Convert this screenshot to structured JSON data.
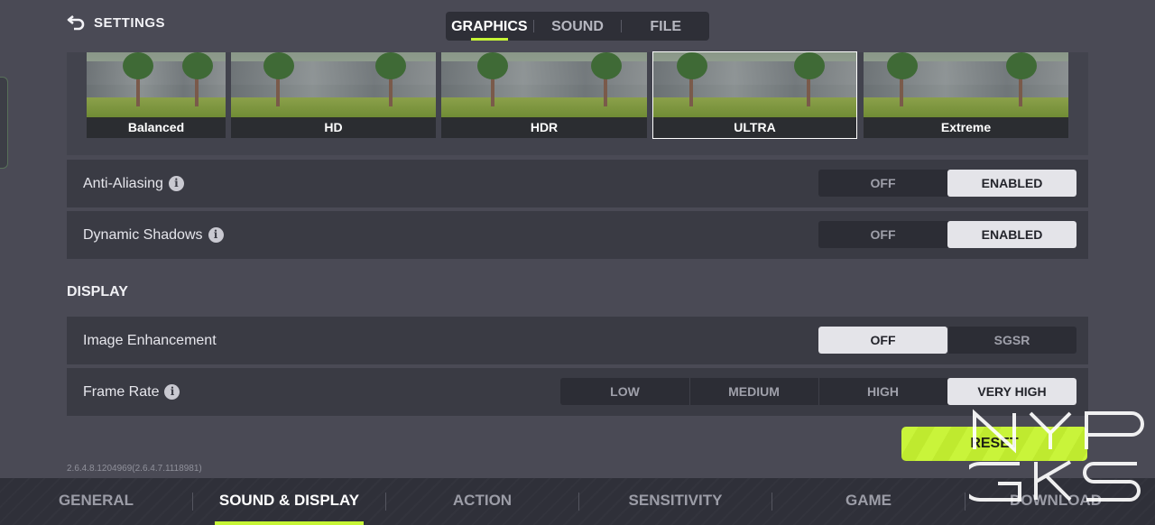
{
  "header": {
    "back_label": "SETTINGS",
    "tabs": [
      {
        "label": "GRAPHICS",
        "active": true
      },
      {
        "label": "SOUND",
        "active": false
      },
      {
        "label": "FILE",
        "active": false
      }
    ]
  },
  "presets": [
    {
      "label": "Balanced",
      "selected": false
    },
    {
      "label": "HD",
      "selected": false
    },
    {
      "label": "HDR",
      "selected": false
    },
    {
      "label": "ULTRA",
      "selected": true
    },
    {
      "label": "Extreme",
      "selected": false
    }
  ],
  "graphics_rows": {
    "anti_aliasing": {
      "label": "Anti-Aliasing",
      "options": [
        "OFF",
        "ENABLED"
      ],
      "selected": "ENABLED"
    },
    "dynamic_shadows": {
      "label": "Dynamic Shadows",
      "options": [
        "OFF",
        "ENABLED"
      ],
      "selected": "ENABLED"
    }
  },
  "display": {
    "title": "DISPLAY",
    "image_enhancement": {
      "label": "Image Enhancement",
      "options": [
        "OFF",
        "SGSR"
      ],
      "selected": "OFF"
    },
    "frame_rate": {
      "label": "Frame Rate",
      "options": [
        "LOW",
        "MEDIUM",
        "HIGH",
        "VERY HIGH"
      ],
      "selected": "VERY HIGH"
    }
  },
  "version": "2.6.4.8.1204969(2.6.4.7.1118981)",
  "reset_label": "RESET",
  "bottom_nav": [
    {
      "label": "GENERAL",
      "active": false
    },
    {
      "label": "SOUND & DISPLAY",
      "active": true
    },
    {
      "label": "ACTION",
      "active": false
    },
    {
      "label": "SENSITIVITY",
      "active": false
    },
    {
      "label": "GAME",
      "active": false
    },
    {
      "label": "DOWNLOAD",
      "active": false
    }
  ],
  "icons": {
    "back": "back-arrow-icon",
    "info": "info-icon"
  },
  "info_glyph": "i",
  "colors": {
    "accent": "#c6f536",
    "background": "#4a4a55",
    "row_bg": "#3a3b44",
    "selected_option": "#e4e4e9"
  }
}
